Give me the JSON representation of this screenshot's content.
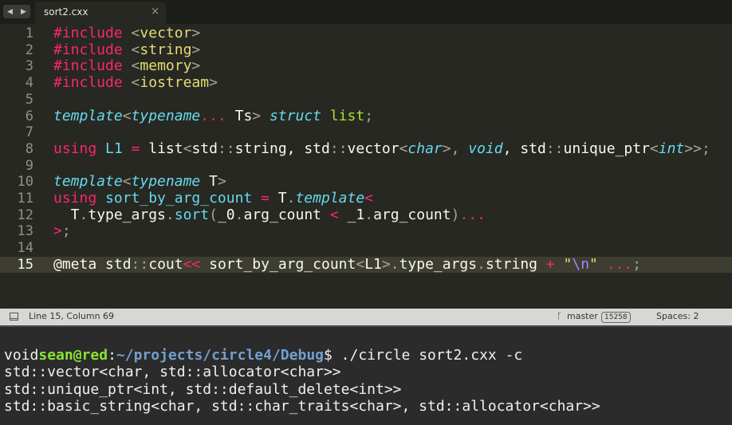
{
  "tab": {
    "title": "sort2.cxx",
    "close": "×"
  },
  "nav": {
    "back": "◀",
    "forward": "▶"
  },
  "editor": {
    "active_line": 15,
    "lines": [
      {
        "n": "1",
        "segments": [
          {
            "t": "#include ",
            "c": "pk"
          },
          {
            "t": "<",
            "c": "br"
          },
          {
            "t": "vector",
            "c": "ye"
          },
          {
            "t": ">",
            "c": "br"
          }
        ]
      },
      {
        "n": "2",
        "segments": [
          {
            "t": "#include ",
            "c": "pk"
          },
          {
            "t": "<",
            "c": "br"
          },
          {
            "t": "string",
            "c": "ye"
          },
          {
            "t": ">",
            "c": "br"
          }
        ]
      },
      {
        "n": "3",
        "segments": [
          {
            "t": "#include ",
            "c": "pk"
          },
          {
            "t": "<",
            "c": "br"
          },
          {
            "t": "memory",
            "c": "ye"
          },
          {
            "t": ">",
            "c": "br"
          }
        ]
      },
      {
        "n": "4",
        "segments": [
          {
            "t": "#include ",
            "c": "pk"
          },
          {
            "t": "<",
            "c": "br"
          },
          {
            "t": "iostream",
            "c": "ye"
          },
          {
            "t": ">",
            "c": "br"
          }
        ]
      },
      {
        "n": "5",
        "segments": []
      },
      {
        "n": "6",
        "segments": [
          {
            "t": "template",
            "c": "cy"
          },
          {
            "t": "<",
            "c": "br"
          },
          {
            "t": "typename",
            "c": "cy"
          },
          {
            "t": "...",
            "c": "pk"
          },
          {
            "t": " Ts",
            "c": "pl"
          },
          {
            "t": "> ",
            "c": "br"
          },
          {
            "t": "struct",
            "c": "cy"
          },
          {
            "t": " ",
            "c": "pl"
          },
          {
            "t": "list",
            "c": "gr"
          },
          {
            "t": ";",
            "c": "br"
          }
        ]
      },
      {
        "n": "7",
        "segments": []
      },
      {
        "n": "8",
        "segments": [
          {
            "t": "using",
            "c": "pk"
          },
          {
            "t": " ",
            "c": "pl"
          },
          {
            "t": "L1",
            "c": "cn"
          },
          {
            "t": " = ",
            "c": "pk"
          },
          {
            "t": "list",
            "c": "pl"
          },
          {
            "t": "<",
            "c": "br"
          },
          {
            "t": "std",
            "c": "pl"
          },
          {
            "t": "::",
            "c": "br"
          },
          {
            "t": "string, std",
            "c": "pl"
          },
          {
            "t": "::",
            "c": "br"
          },
          {
            "t": "vector",
            "c": "pl"
          },
          {
            "t": "<",
            "c": "br"
          },
          {
            "t": "char",
            "c": "cy"
          },
          {
            "t": ">, ",
            "c": "br"
          },
          {
            "t": "void",
            "c": "cy"
          },
          {
            "t": ", std",
            "c": "pl"
          },
          {
            "t": "::",
            "c": "br"
          },
          {
            "t": "unique_ptr",
            "c": "pl"
          },
          {
            "t": "<",
            "c": "br"
          },
          {
            "t": "int",
            "c": "cy"
          },
          {
            "t": ">>;",
            "c": "br"
          }
        ]
      },
      {
        "n": "9",
        "segments": []
      },
      {
        "n": "10",
        "segments": [
          {
            "t": "template",
            "c": "cy"
          },
          {
            "t": "<",
            "c": "br"
          },
          {
            "t": "typename",
            "c": "cy"
          },
          {
            "t": " T",
            "c": "pl"
          },
          {
            "t": ">",
            "c": "br"
          }
        ]
      },
      {
        "n": "11",
        "segments": [
          {
            "t": "using",
            "c": "pk"
          },
          {
            "t": " ",
            "c": "pl"
          },
          {
            "t": "sort_by_arg_count",
            "c": "cn"
          },
          {
            "t": " = ",
            "c": "pk"
          },
          {
            "t": "T",
            "c": "pl"
          },
          {
            "t": ".",
            "c": "br"
          },
          {
            "t": "template",
            "c": "cy"
          },
          {
            "t": "<",
            "c": "pk"
          }
        ]
      },
      {
        "n": "12",
        "segments": [
          {
            "t": "  T",
            "c": "pl"
          },
          {
            "t": ".",
            "c": "br"
          },
          {
            "t": "type_args",
            "c": "pl"
          },
          {
            "t": ".",
            "c": "br"
          },
          {
            "t": "sort",
            "c": "cn"
          },
          {
            "t": "(",
            "c": "br"
          },
          {
            "t": "_0",
            "c": "pl"
          },
          {
            "t": ".",
            "c": "br"
          },
          {
            "t": "arg_count ",
            "c": "pl"
          },
          {
            "t": "<",
            "c": "pk"
          },
          {
            "t": " _1",
            "c": "pl"
          },
          {
            "t": ".",
            "c": "br"
          },
          {
            "t": "arg_count",
            "c": "pl"
          },
          {
            "t": ")",
            "c": "br"
          },
          {
            "t": "...",
            "c": "pk"
          }
        ]
      },
      {
        "n": "13",
        "segments": [
          {
            "t": ">",
            "c": "pk"
          },
          {
            "t": ";",
            "c": "br"
          }
        ]
      },
      {
        "n": "14",
        "segments": []
      },
      {
        "n": "15",
        "segments": [
          {
            "t": "@meta std",
            "c": "pl"
          },
          {
            "t": "::",
            "c": "br"
          },
          {
            "t": "cout",
            "c": "pl"
          },
          {
            "t": "<<",
            "c": "pk"
          },
          {
            "t": " sort_by_arg_count",
            "c": "pl"
          },
          {
            "t": "<",
            "c": "br"
          },
          {
            "t": "L1",
            "c": "pl"
          },
          {
            "t": ">",
            "c": "br"
          },
          {
            "t": ".",
            "c": "br"
          },
          {
            "t": "type_args",
            "c": "pl"
          },
          {
            "t": ".",
            "c": "br"
          },
          {
            "t": "string ",
            "c": "pl"
          },
          {
            "t": "+",
            "c": "pk"
          },
          {
            "t": " \"",
            "c": "ye"
          },
          {
            "t": "\\n",
            "c": "pu"
          },
          {
            "t": "\" ",
            "c": "ye"
          },
          {
            "t": "...",
            "c": "pk"
          },
          {
            "t": ";",
            "c": "br"
          }
        ]
      }
    ]
  },
  "status": {
    "position": "Line 15, Column 69",
    "branch_icon": "ᚴ",
    "branch": "master",
    "branch_count": "15258",
    "indent": "Spaces: 2"
  },
  "terminal": {
    "prompt_user": "sean@red",
    "prompt_sep": ":",
    "prompt_path": "~/projects/circle4/Debug",
    "prompt_cmd": "$ ./circle sort2.cxx -c",
    "output": [
      "void",
      "std::vector<char, std::allocator<char>>",
      "std::unique_ptr<int, std::default_delete<int>>",
      "std::basic_string<char, std::char_traits<char>, std::allocator<char>>"
    ]
  }
}
